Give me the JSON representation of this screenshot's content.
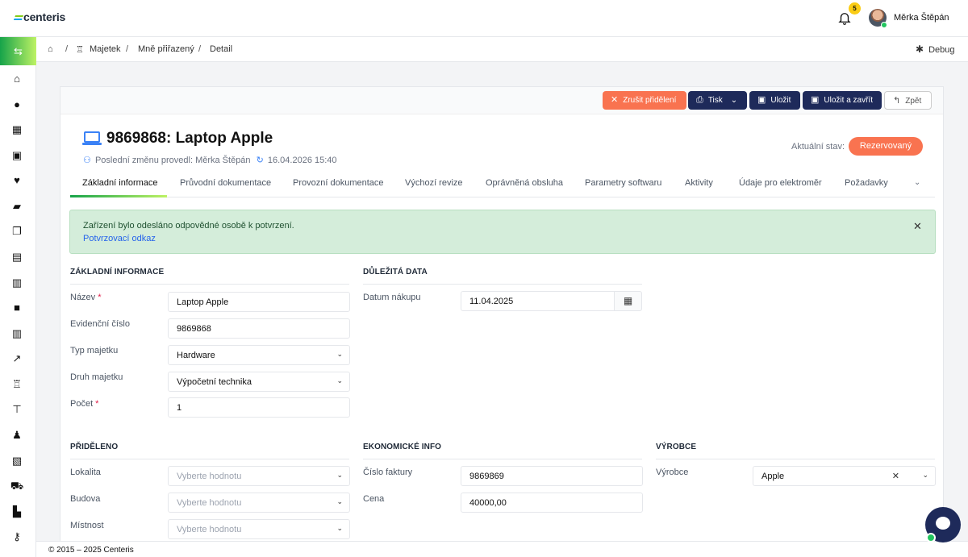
{
  "header": {
    "logo": "centeris",
    "notifications_count": "5",
    "user_name": "Měrka Štěpán"
  },
  "sidebar": {
    "toggle_icon": "⇆",
    "icons": [
      "home-icon",
      "user-icon",
      "calendar-icon",
      "grid-icon",
      "heart-icon",
      "chat-icon",
      "documents-icon",
      "clipboard-icon",
      "inventory-icon",
      "book-icon",
      "inventory-alt-icon",
      "chart-line-icon",
      "chair-icon",
      "signpost-icon",
      "person-desk-icon",
      "book-open-icon",
      "cart-icon",
      "chart-bar-icon",
      "key-icon"
    ]
  },
  "breadcrumb": {
    "items": [
      "Majetek",
      "Mně přiřazený",
      "Detail"
    ],
    "debug_label": "Debug"
  },
  "toolbar": {
    "cancel_assign": "Zrušit přidělení",
    "print": "Tisk",
    "save": "Uložit",
    "save_close": "Uložit a zavřít",
    "back": "Zpět"
  },
  "detail": {
    "title": "9869868: Laptop Apple",
    "last_change_label": "Poslední změnu provedl: Měrka Štěpán",
    "last_change_date": "16.04.2026 15:40",
    "status_label": "Aktuální stav:",
    "status_value": "Rezervovaný"
  },
  "tabs": [
    "Základní informace",
    "Průvodní dokumentace",
    "Provozní dokumentace",
    "Výchozí revize",
    "Oprávněná obsluha",
    "Parametry softwaru",
    "Aktivity",
    "Údaje pro elektroměr",
    "Požadavky"
  ],
  "alert": {
    "message": "Zařízení bylo odesláno odpovědné osobě k potvrzení.",
    "link": "Potvrzovací odkaz"
  },
  "basic_info": {
    "title": "ZÁKLADNÍ INFORMACE",
    "name_label": "Název",
    "name_value": "Laptop Apple",
    "evid_label": "Evidenční číslo",
    "evid_value": "9869868",
    "type_label": "Typ majetku",
    "type_value": "Hardware",
    "kind_label": "Druh majetku",
    "kind_value": "Výpočetní technika",
    "count_label": "Počet",
    "count_value": "1"
  },
  "important_dates": {
    "title": "DŮLEŽITÁ DATA",
    "purchase_label": "Datum nákupu",
    "purchase_value": "11.04.2025"
  },
  "assigned": {
    "title": "PŘIDĚLENO",
    "locality_label": "Lokalita",
    "building_label": "Budova",
    "room_label": "Místnost",
    "placeholder": "Vyberte hodnotu"
  },
  "economic": {
    "title": "EKONOMICKÉ INFO",
    "invoice_label": "Číslo faktury",
    "invoice_value": "9869869",
    "price_label": "Cena",
    "price_value": "40000,00"
  },
  "manufacturer": {
    "title": "VÝROBCE",
    "label": "Výrobce",
    "value": "Apple"
  },
  "footer": {
    "text": "© 2015 – 2025 Centeris"
  }
}
